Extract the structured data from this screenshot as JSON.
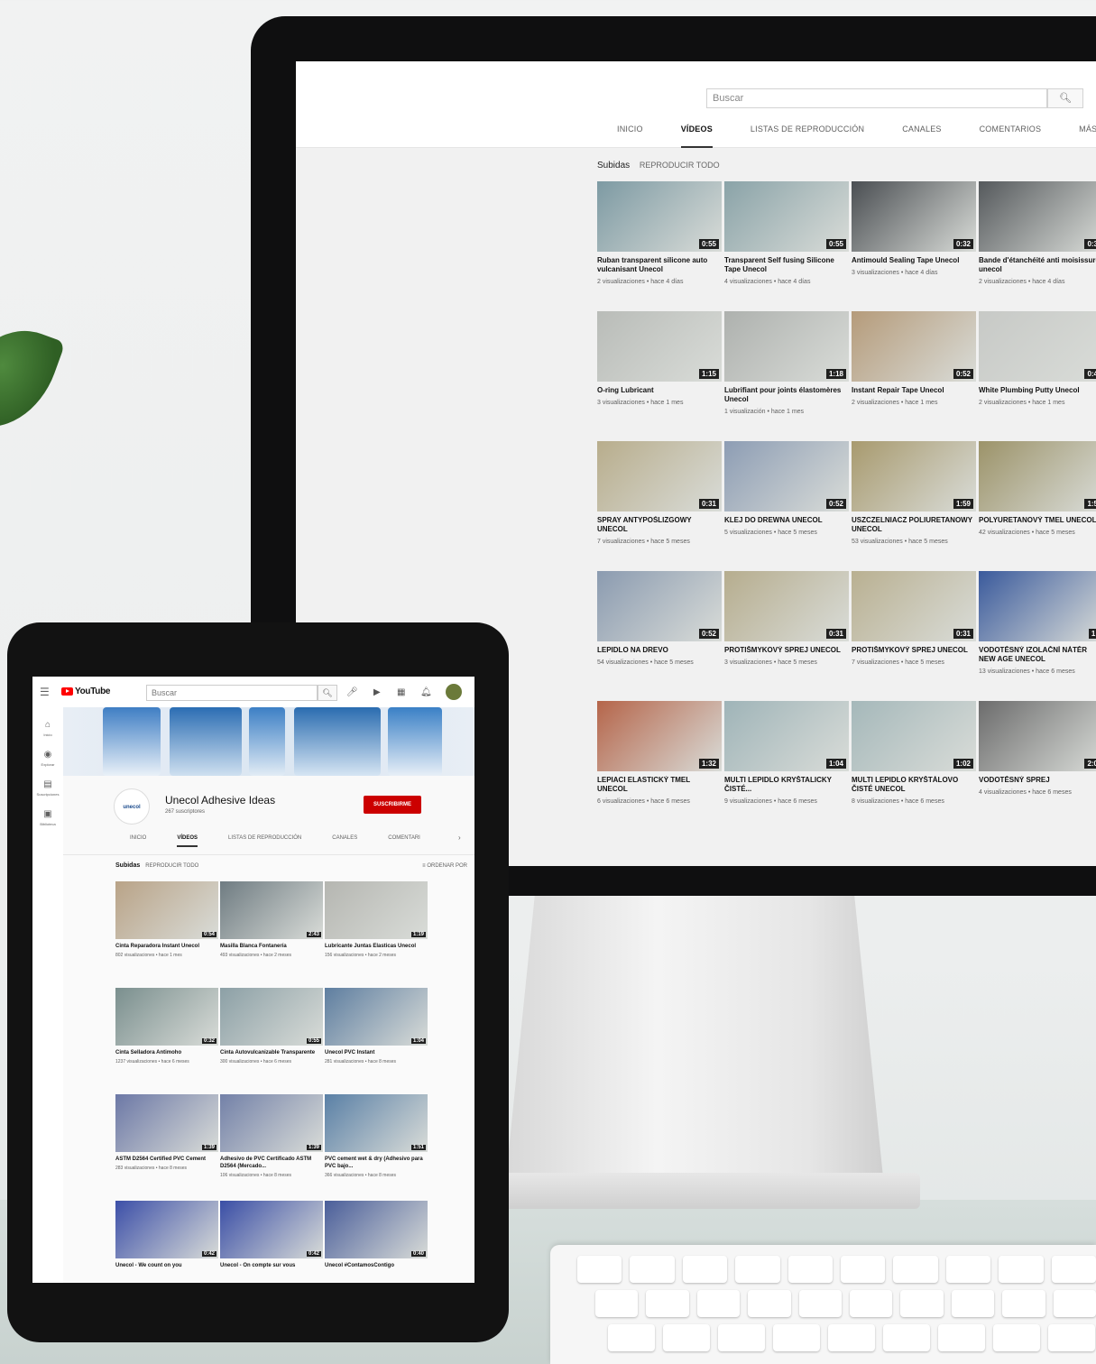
{
  "monitor": {
    "search_placeholder": "Buscar",
    "search_icon": "search-icon",
    "tabs": [
      "INICIO",
      "VÍDEOS",
      "LISTAS DE REPRODUCCIÓN",
      "CANALES",
      "COMENTARIOS",
      "MÁS INFOR"
    ],
    "section": "Subidas",
    "section_action": "REPRODUCIR TODO",
    "videos": [
      {
        "title": "Ruban transparent silicone auto vulcanisant Unecol",
        "meta": "2 visualizaciones • hace 4 días",
        "duration": "0:55",
        "color": "#7d9aa3"
      },
      {
        "title": "Transparent Self fusing Silicone Tape Unecol",
        "meta": "4 visualizaciones • hace 4 días",
        "duration": "0:55",
        "color": "#8aa3a8"
      },
      {
        "title": "Antimould Sealing Tape Unecol",
        "meta": "3 visualizaciones • hace 4 días",
        "duration": "0:32",
        "color": "#4a4e52"
      },
      {
        "title": "Bande d'étanchéité anti moisissure unecol",
        "meta": "2 visualizaciones • hace 4 días",
        "duration": "0:3",
        "color": "#55595c"
      },
      {
        "title": "O-ring Lubricant",
        "meta": "3 visualizaciones • hace 1 mes",
        "duration": "1:15",
        "color": "#b9bcb8"
      },
      {
        "title": "Lubrifiant pour joints élastomères Unecol",
        "meta": "1 visualización • hace 1 mes",
        "duration": "1:18",
        "color": "#aeb1ae"
      },
      {
        "title": "Instant Repair Tape Unecol",
        "meta": "2 visualizaciones • hace 1 mes",
        "duration": "0:52",
        "color": "#b59b7a"
      },
      {
        "title": "White Plumbing Putty Unecol",
        "meta": "2 visualizaciones • hace 1 mes",
        "duration": "0:4",
        "color": "#c7c9c6"
      },
      {
        "title": "SPRAY ANTYPOŚLIZGOWY UNECOL",
        "meta": "7 visualizaciones • hace 5 meses",
        "duration": "0:31",
        "color": "#b8ad8c"
      },
      {
        "title": "KLEJ DO DREWNA UNECOL",
        "meta": "5 visualizaciones • hace 5 meses",
        "duration": "0:52",
        "color": "#8d9db4"
      },
      {
        "title": "USZCZELNIACZ POLIURETANOWY UNECOL",
        "meta": "53 visualizaciones • hace 5 meses",
        "duration": "1:59",
        "color": "#a89a6e"
      },
      {
        "title": "POLYURETANOVÝ TMEL UNECOL",
        "meta": "42 visualizaciones • hace 5 meses",
        "duration": "1:5",
        "color": "#9c9369"
      },
      {
        "title": "LEPIDLO NA DREVO",
        "meta": "54 visualizaciones • hace 5 meses",
        "duration": "0:52",
        "color": "#8b9bb0"
      },
      {
        "title": "PROTIŠMYKOVÝ SPREJ UNECOL",
        "meta": "3 visualizaciones • hace 5 meses",
        "duration": "0:31",
        "color": "#b6ad8e"
      },
      {
        "title": "PROTIŠMYKOVÝ SPREJ UNECOL",
        "meta": "7 visualizaciones • hace 5 meses",
        "duration": "0:31",
        "color": "#b9b091"
      },
      {
        "title": "VODOTĚSNÝ IZOLAČNÍ NÁTĚR NEW AGE UNECOL",
        "meta": "13 visualizaciones • hace 6 meses",
        "duration": "1:",
        "color": "#3a5a9c"
      },
      {
        "title": "LEPIACI ELASTICKÝ TMEL UNECOL",
        "meta": "6 visualizaciones • hace 6 meses",
        "duration": "1:32",
        "color": "#b5654a"
      },
      {
        "title": "MULTI LEPIDLO KRYŠTALICKY ČISTÉ...",
        "meta": "9 visualizaciones • hace 6 meses",
        "duration": "1:04",
        "color": "#9fb4b8"
      },
      {
        "title": "MULTI LEPIDLO KRYŠTÁLOVO ČISTÉ UNECOL",
        "meta": "8 visualizaciones • hace 6 meses",
        "duration": "1:02",
        "color": "#a5b8ba"
      },
      {
        "title": "VODOTĚSNÝ SPREJ",
        "meta": "4 visualizaciones • hace 6 meses",
        "duration": "2:0",
        "color": "#6c6c6c"
      }
    ]
  },
  "tablet": {
    "logo_text": "YouTube",
    "search_placeholder": "Buscar",
    "sidebar": [
      "Inicio",
      "Explorar",
      "Suscripciones",
      "Biblioteca"
    ],
    "channel_logo": "unecol",
    "channel_name": "Unecol Adhesive Ideas",
    "subscribers": "267 suscriptores",
    "subscribe_label": "SUSCRIBIRME",
    "tabs": [
      "INICIO",
      "VÍDEOS",
      "LISTAS DE REPRODUCCIÓN",
      "CANALES",
      "COMENTARI"
    ],
    "section": "Subidas",
    "section_action": "REPRODUCIR TODO",
    "sort_label": "ORDENAR POR",
    "videos": [
      {
        "title": "Cinta Reparadora Instant Unecol",
        "meta": "802 visualizaciones • hace 1 mes",
        "duration": "0:54",
        "color": "#b9a387"
      },
      {
        "title": "Masilla Blanca Fontanería",
        "meta": "493 visualizaciones • hace 2 meses",
        "duration": "2:43",
        "color": "#6f7c82"
      },
      {
        "title": "Lubricante Juntas Elasticas Unecol",
        "meta": "156 visualizaciones • hace 2 meses",
        "duration": "1:19",
        "color": "#b5b6b1"
      },
      {
        "title": "Cinta Selladora Antimoho",
        "meta": "1237 visualizaciones • hace 6 meses",
        "duration": "0:32",
        "color": "#7a8f8e"
      },
      {
        "title": "Cinta Autovulcanizable Transparente",
        "meta": "300 visualizaciones • hace 6 meses",
        "duration": "0:55",
        "color": "#8ca0a6"
      },
      {
        "title": "Unecol PVC Instant",
        "meta": "281 visualizaciones • hace 8 meses",
        "duration": "1:04",
        "color": "#5e7ea0"
      },
      {
        "title": "ASTM D2564 Certified PVC Cement",
        "meta": "283 visualizaciones • hace 8 meses",
        "duration": "1:39",
        "color": "#6c78a6"
      },
      {
        "title": "Adhesivo de PVC Certificado ASTM D2564 (Mercado...",
        "meta": "106 visualizaciones • hace 8 meses",
        "duration": "1:39",
        "color": "#7381a8"
      },
      {
        "title": "PVC cement wet & dry (Adhesivo para PVC bajo...",
        "meta": "366 visualizaciones • hace 8 meses",
        "duration": "1:51",
        "color": "#5a80a6"
      },
      {
        "title": "Unecol - We count on you",
        "meta": "",
        "duration": "0:42",
        "color": "#3c4fa8"
      },
      {
        "title": "Unecol - On compte sur vous",
        "meta": "",
        "duration": "0:42",
        "color": "#3a4ea6"
      },
      {
        "title": "Unecol #ContamosContigo",
        "meta": "",
        "duration": "0:40",
        "color": "#4a5e9a"
      }
    ]
  }
}
